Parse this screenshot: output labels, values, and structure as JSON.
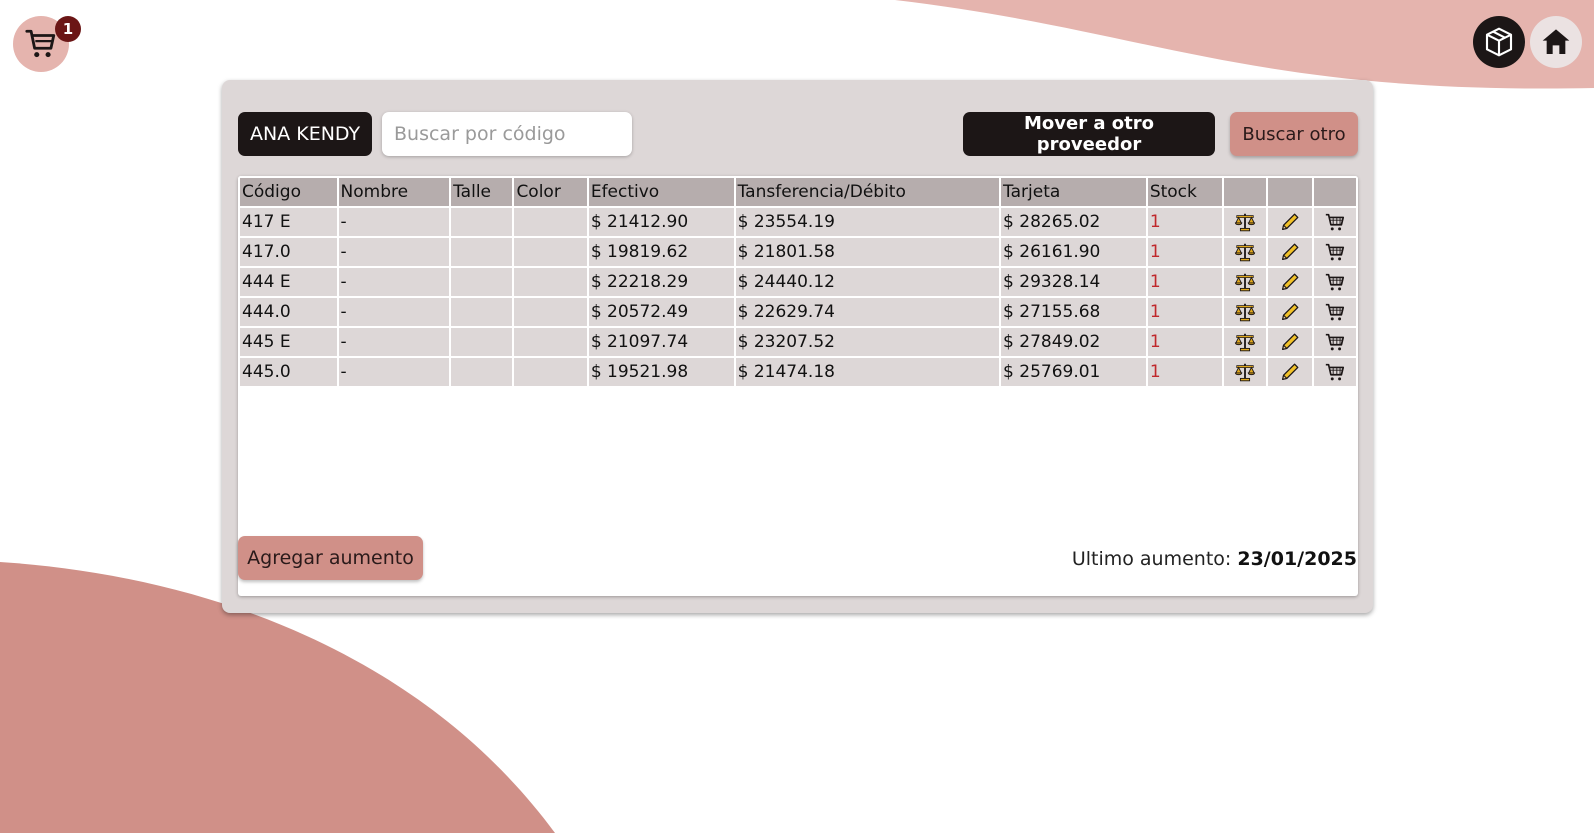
{
  "colors": {
    "accent": "#d09088",
    "dark": "#1c1616",
    "panel": "#ddd7d7",
    "table_header": "#b6adad",
    "stock_text": "#c0282c",
    "badge": "#6b1616"
  },
  "header": {
    "cart_icon": "cart-icon",
    "cart_count": "1",
    "box_icon": "box-icon",
    "home_icon": "home-icon"
  },
  "toolbar": {
    "supplier_name": "ANA KENDY",
    "search_placeholder": "Buscar por código",
    "move_label": "Mover a otro proveedor",
    "search_other_label": "Buscar otro"
  },
  "table": {
    "columns": [
      "Código",
      "Nombre",
      "Talle",
      "Color",
      "Efectivo",
      "Tansferencia/Débito",
      "Tarjeta",
      "Stock",
      "",
      "",
      ""
    ],
    "action_icons": [
      "scale-icon",
      "pencil-icon",
      "cart-add-icon"
    ],
    "rows": [
      {
        "codigo": "417 E",
        "nombre": "-",
        "talle": "",
        "color": "",
        "efectivo": "$ 21412.90",
        "transferencia": "$ 23554.19",
        "tarjeta": "$ 28265.02",
        "stock": "1"
      },
      {
        "codigo": "417.0",
        "nombre": "-",
        "talle": "",
        "color": "",
        "efectivo": "$ 19819.62",
        "transferencia": "$ 21801.58",
        "tarjeta": "$ 26161.90",
        "stock": "1"
      },
      {
        "codigo": "444 E",
        "nombre": "-",
        "talle": "",
        "color": "",
        "efectivo": "$ 22218.29",
        "transferencia": "$ 24440.12",
        "tarjeta": "$ 29328.14",
        "stock": "1"
      },
      {
        "codigo": "444.0",
        "nombre": "-",
        "talle": "",
        "color": "",
        "efectivo": "$ 20572.49",
        "transferencia": "$ 22629.74",
        "tarjeta": "$ 27155.68",
        "stock": "1"
      },
      {
        "codigo": "445 E",
        "nombre": "-",
        "talle": "",
        "color": "",
        "efectivo": "$ 21097.74",
        "transferencia": "$ 23207.52",
        "tarjeta": "$ 27849.02",
        "stock": "1"
      },
      {
        "codigo": "445.0",
        "nombre": "-",
        "talle": "",
        "color": "",
        "efectivo": "$ 19521.98",
        "transferencia": "$ 21474.18",
        "tarjeta": "$ 25769.01",
        "stock": "1"
      }
    ]
  },
  "footer": {
    "add_label": "Agregar aumento",
    "last_increase_label": "Ultimo aumento:",
    "last_increase_date": "23/01/2025"
  }
}
